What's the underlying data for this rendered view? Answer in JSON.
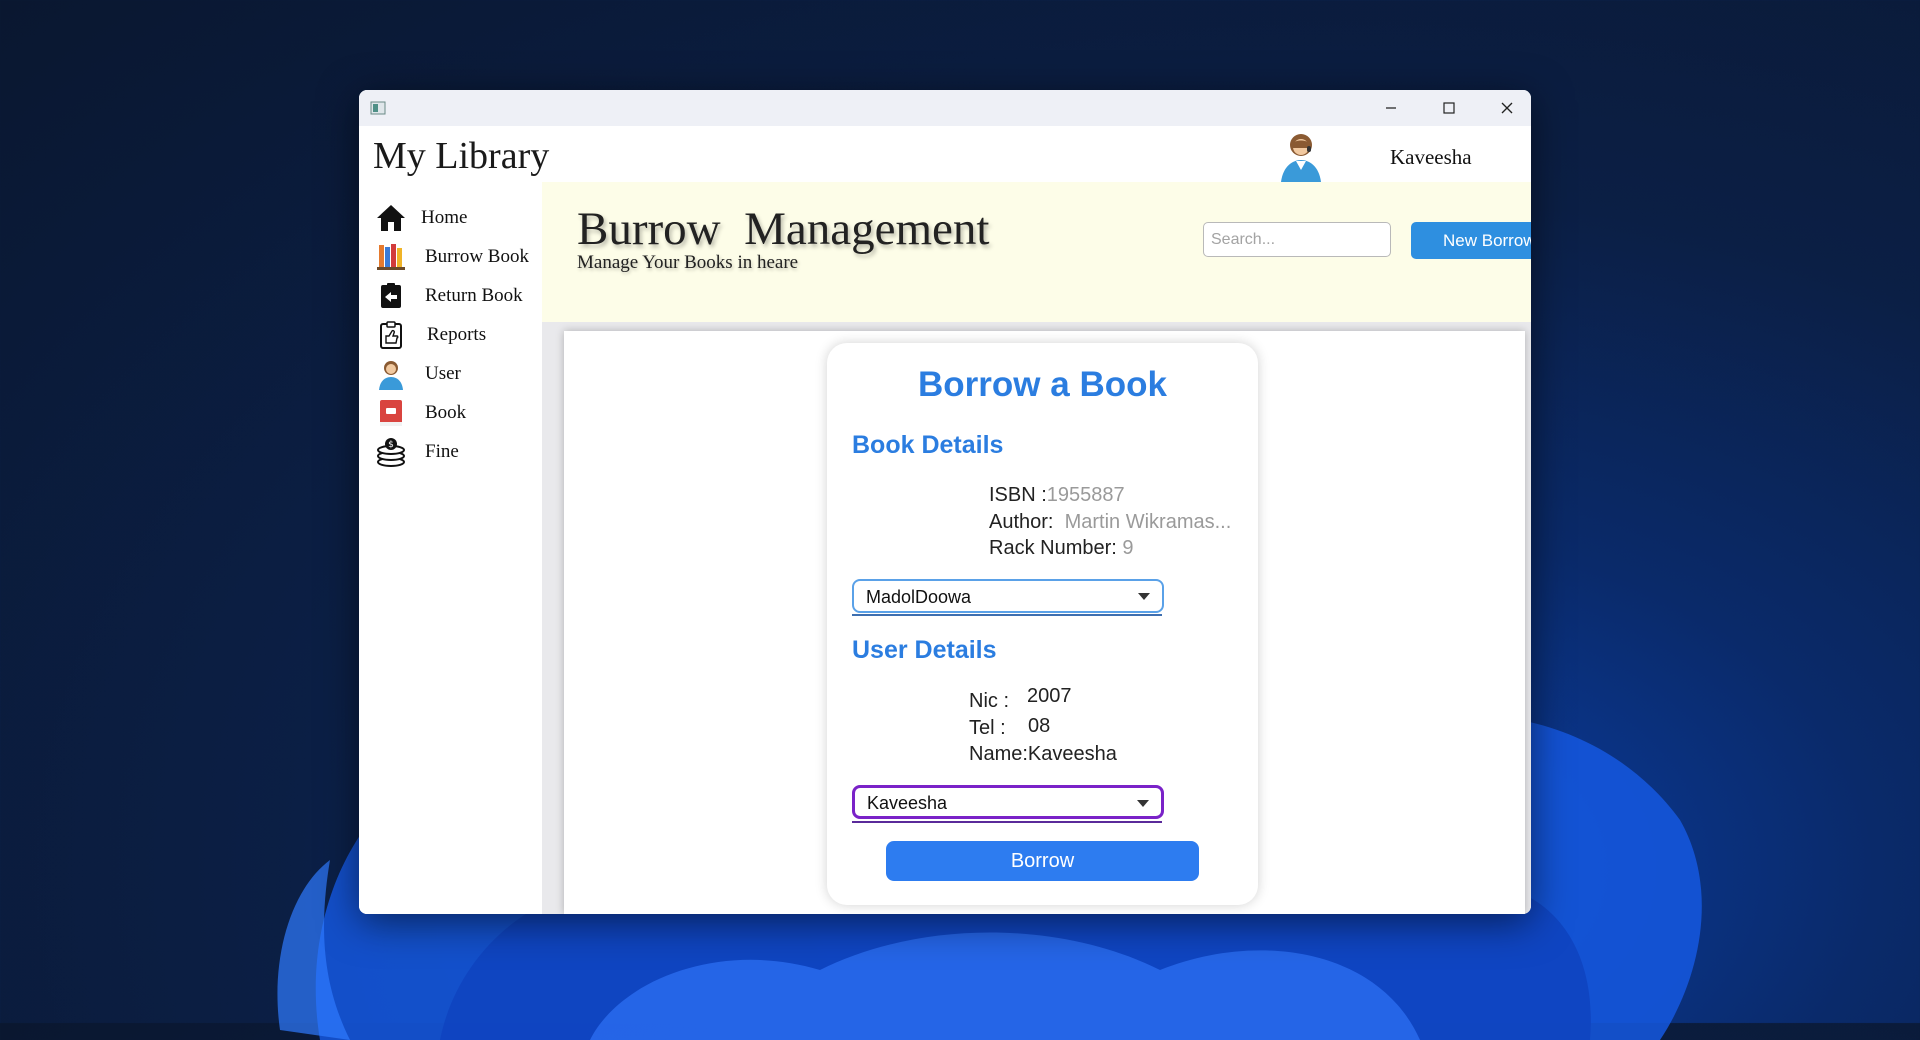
{
  "colors": {
    "accent": "#2b7de0",
    "new_button": "#2e8fe0",
    "borrow_button": "#2d7cf0",
    "header_band": "#fdfde8",
    "focused_dropdown_border": "#7a22c8"
  },
  "window": {
    "controls": [
      "minimize-icon",
      "maximize-icon",
      "close-icon"
    ]
  },
  "app": {
    "title": "My Library",
    "user_name": "Kaveesha"
  },
  "sidebar": {
    "items": [
      {
        "label": "Home",
        "icon": "home-icon"
      },
      {
        "label": "Burrow Book",
        "icon": "books-icon"
      },
      {
        "label": "Return Book",
        "icon": "return-icon"
      },
      {
        "label": "Reports",
        "icon": "clipboard-thumb-icon"
      },
      {
        "label": "User",
        "icon": "user-icon"
      },
      {
        "label": "Book",
        "icon": "book-icon"
      },
      {
        "label": "Fine",
        "icon": "coins-icon"
      }
    ]
  },
  "header": {
    "title": "Burrow  Management",
    "subtitle": "Manage Your Books in heare",
    "search_placeholder": "Search...",
    "new_button_label": "New Borrow"
  },
  "card": {
    "title": "Borrow a Book",
    "book_section_title": "Book Details",
    "isbn_label": "ISBN :",
    "isbn_value": "1955887",
    "author_label": "Author:",
    "author_value": "Martin Wikramas...",
    "rack_label": "Rack Number:",
    "rack_value": "9",
    "book_select_value": "MadolDoowa",
    "user_section_title": "User Details",
    "nic_label": "Nic :",
    "nic_value": "2007",
    "tel_label": "Tel :",
    "tel_value": "08",
    "name_label": "Name:",
    "name_value": "Kaveesha",
    "user_select_value": "Kaveesha",
    "borrow_button_label": "Borrow"
  }
}
